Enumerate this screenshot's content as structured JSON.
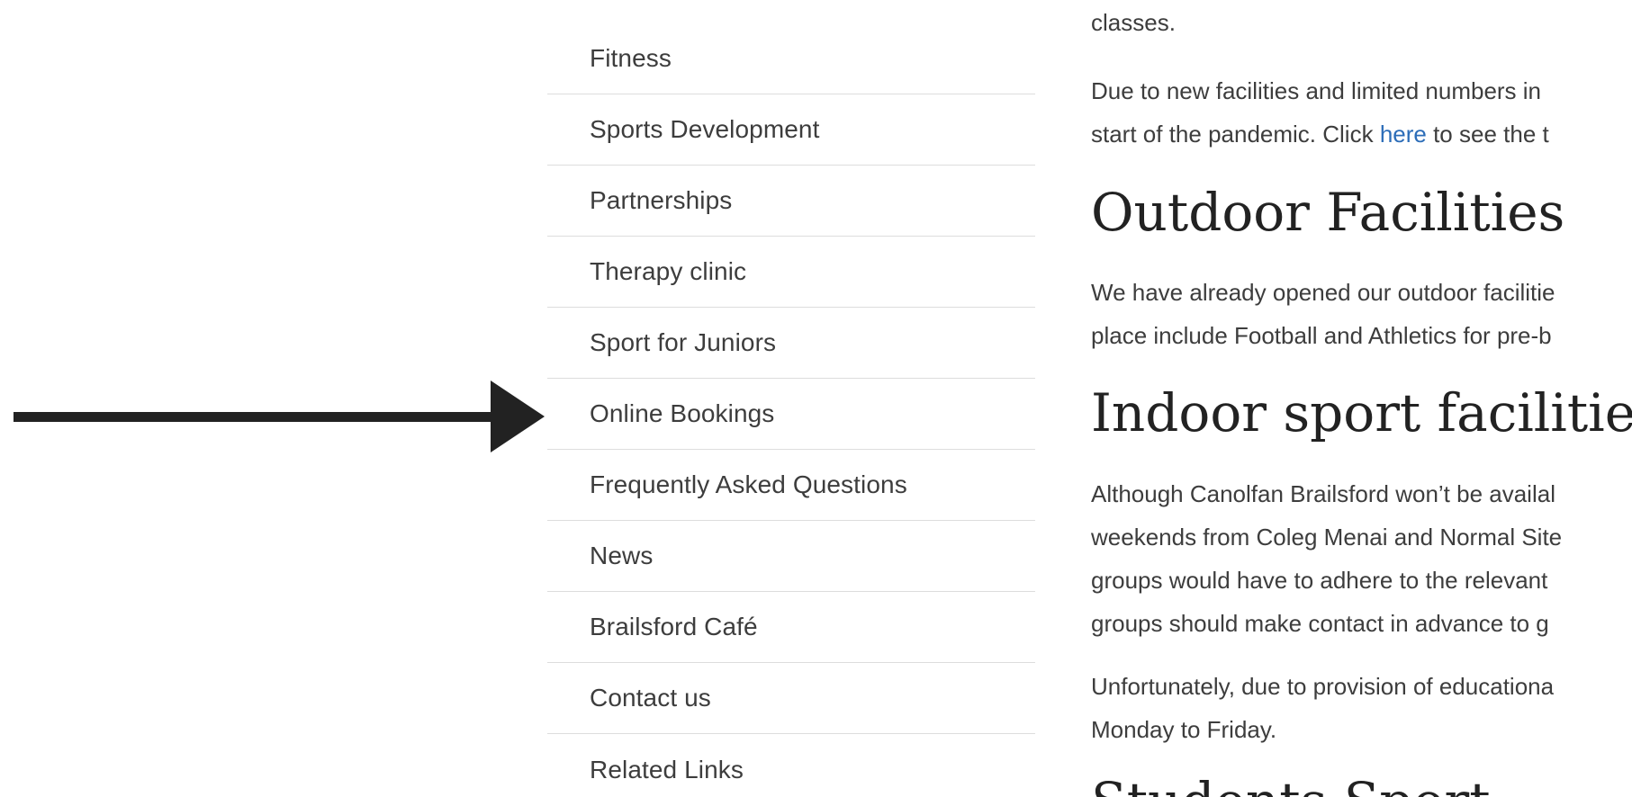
{
  "sidebar": {
    "items": [
      {
        "label": "Fitness"
      },
      {
        "label": "Sports Development"
      },
      {
        "label": "Partnerships"
      },
      {
        "label": "Therapy clinic"
      },
      {
        "label": "Sport for Juniors"
      },
      {
        "label": "Online Bookings"
      },
      {
        "label": "Frequently Asked Questions"
      },
      {
        "label": "News"
      },
      {
        "label": "Brailsford Café"
      },
      {
        "label": "Contact us"
      },
      {
        "label": "Related Links"
      }
    ]
  },
  "content": {
    "top_fragment": "classes.",
    "para1": {
      "line1": "Due to new facilities and limited numbers in",
      "line2_before": "start of the pandemic. Click ",
      "line2_link": "here",
      "line2_after": " to see the t"
    },
    "heading_outdoor": "Outdoor Facilities",
    "para2": {
      "line1": "We have already opened our outdoor facilitie",
      "line2": "place include Football and Athletics for pre-b"
    },
    "heading_indoor": "Indoor sport facilitie",
    "para3": {
      "line1": "Although Canolfan Brailsford won’t be availal",
      "line2": "weekends from Coleg Menai and Normal Site",
      "line3": "groups would have to adhere to the relevant",
      "line4": "groups should make contact in advance to g"
    },
    "para4": {
      "line1": "Unfortunately, due to provision of educationa",
      "line2": "Monday to Friday."
    },
    "heading_students": "Students Sport"
  },
  "colors": {
    "link": "#2c6db8",
    "arrow": "#222222",
    "divider": "#dddddd"
  }
}
